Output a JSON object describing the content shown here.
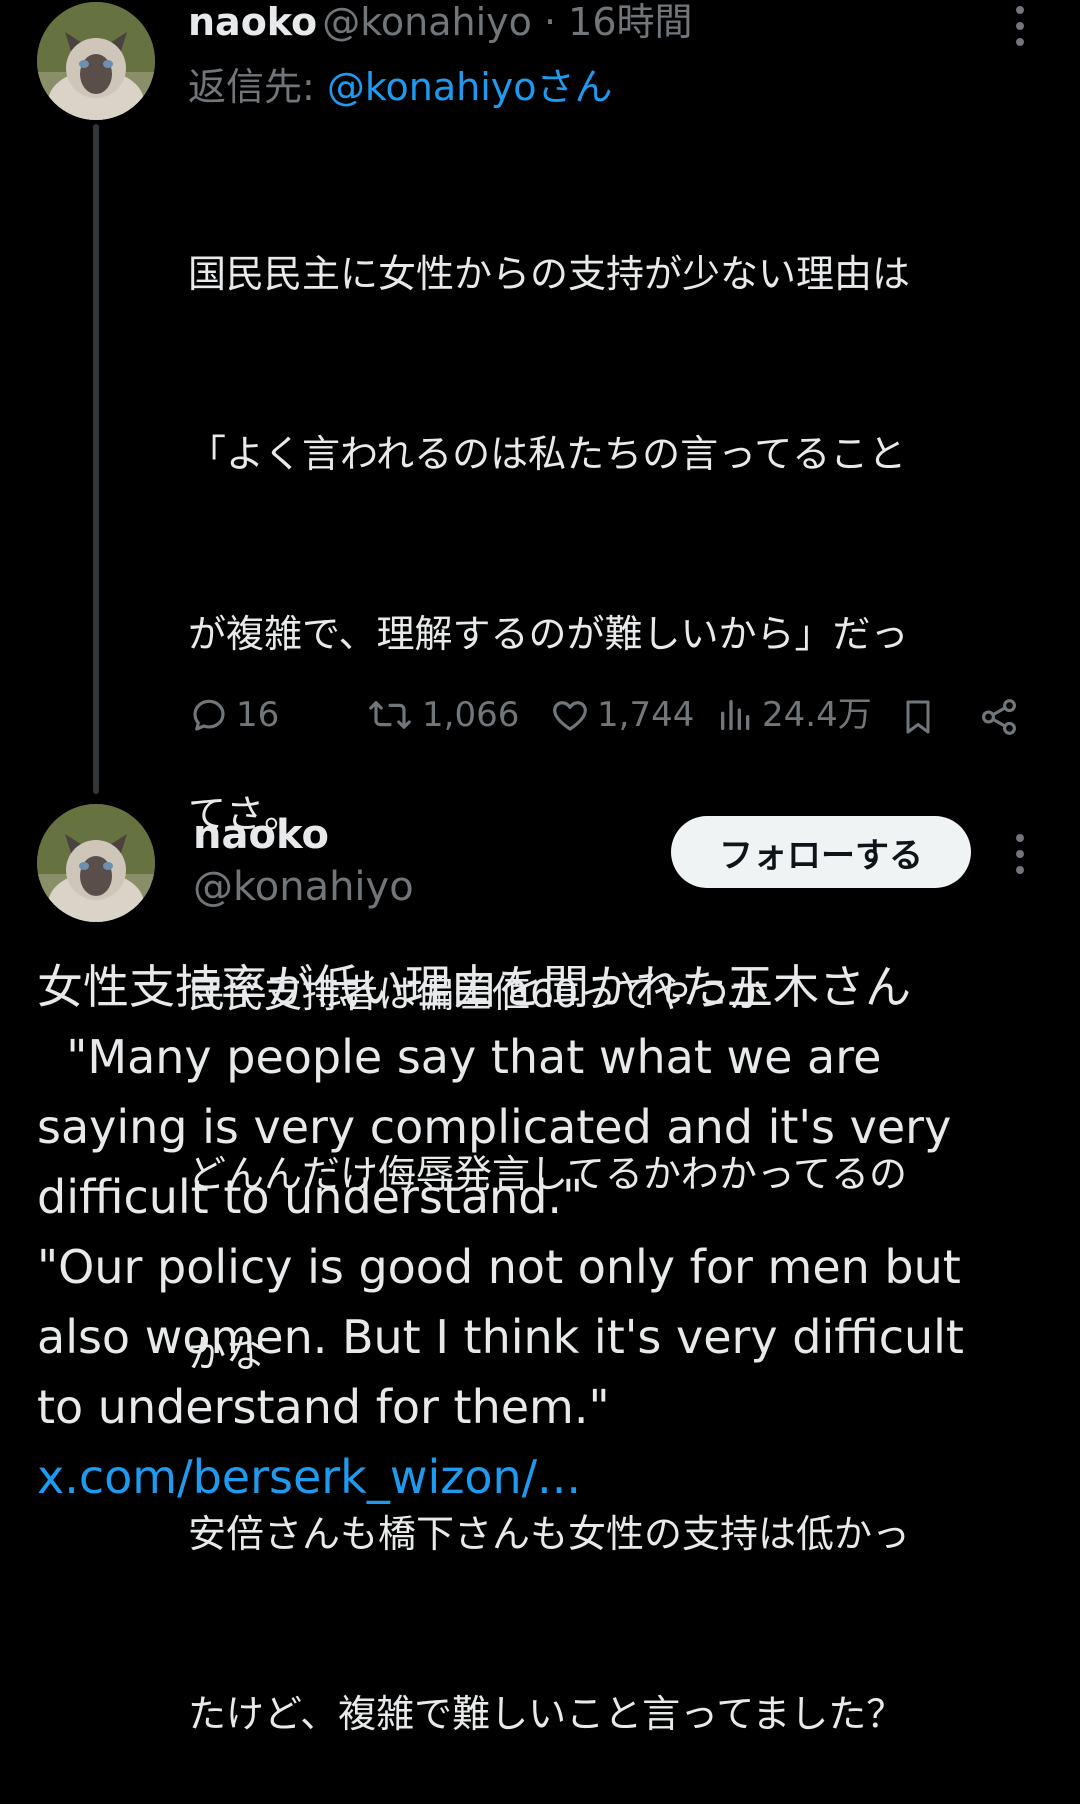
{
  "colors": {
    "background": "#000000",
    "text": "#e7e9ea",
    "secondary": "#71767b",
    "link": "#1d9bf0",
    "button_bg": "#eff3f4"
  },
  "tweet1": {
    "author_name": "naoko",
    "author_handle": "@konahiyo",
    "separator": " · ",
    "time": "16時間",
    "reply_prefix": "返信先: ",
    "reply_to": "@konahiyoさん",
    "body_lines": [
      "国民民主に女性からの支持が少ない理由は",
      "「よく言われるのは私たちの言ってること",
      "が複雑で、理解するのが難しいから」だっ",
      "てさ。",
      "民民支持者は偏差値60ってやつか",
      "どんんだけ侮辱発言してるかわかってるの",
      "かな",
      "安倍さんも橋下さんも女性の支持は低かっ",
      "たけど、複雑で難しいこと言ってました？"
    ],
    "actions": {
      "replies": "16",
      "reposts": "1,066",
      "likes": "1,744",
      "views": "24.4万"
    },
    "icons": [
      "reply-icon",
      "repost-icon",
      "like-icon",
      "views-icon",
      "bookmark-icon",
      "share-icon",
      "more-icon"
    ]
  },
  "tweet2": {
    "author_name": "naoko",
    "author_handle": "@konahiyo",
    "follow_label": "フォローする",
    "body_lines": [
      "女性支持率が低い理由を聞かれた玉木さん",
      "  \"Many people say that what we are",
      "saying is very complicated and it's very",
      "difficult to understand.\"",
      "\"Our policy is good not only for men but",
      "also women. But I think it's very difficult",
      "to understand for them.\""
    ],
    "link": "x.com/berserk_wizon/..."
  }
}
